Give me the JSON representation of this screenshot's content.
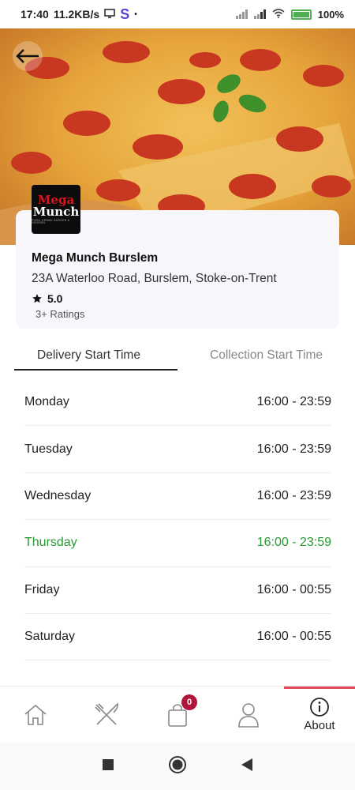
{
  "status_bar": {
    "time": "17:40",
    "speed": "11.2KB/s",
    "s_app": "S",
    "dot": "•",
    "battery": "100%"
  },
  "restaurant": {
    "logo_top": "Mega",
    "logo_bottom": "Munch",
    "logo_tagline": "PIZZA, KEBAB, BURGER & CHICKEN",
    "name": "Mega Munch Burslem",
    "address": "23A Waterloo Road, Burslem, Stoke-on-Trent",
    "rating": "5.0",
    "rating_count": "3+ Ratings"
  },
  "tabs": [
    {
      "label": "Delivery Start Time",
      "active": true
    },
    {
      "label": "Collection Start Time",
      "active": false
    }
  ],
  "schedule": [
    {
      "day": "Monday",
      "hours": "16:00 - 23:59"
    },
    {
      "day": "Tuesday",
      "hours": "16:00 - 23:59"
    },
    {
      "day": "Wednesday",
      "hours": "16:00 - 23:59"
    },
    {
      "day": "Thursday",
      "hours": "16:00 - 23:59",
      "highlighted": true
    },
    {
      "day": "Friday",
      "hours": "16:00 - 00:55"
    },
    {
      "day": "Saturday",
      "hours": "16:00 - 00:55"
    }
  ],
  "bottom_nav": {
    "items": [
      "home-icon",
      "restaurant-icon",
      "cart-icon",
      "profile-icon",
      "info-icon"
    ],
    "cart_count": "0",
    "about_label": "About"
  },
  "colors": {
    "highlight": "#279a31",
    "active_tab_indicator": "#e14b5a",
    "badge": "#b0163a"
  }
}
